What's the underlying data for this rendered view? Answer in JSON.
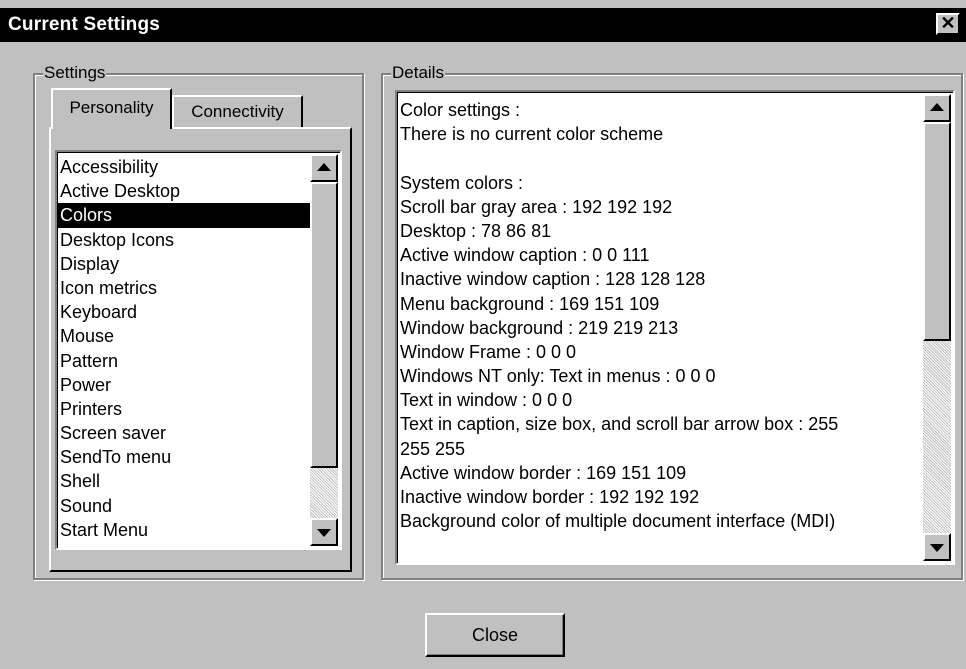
{
  "window": {
    "title": "Current Settings",
    "close_glyph": "✕"
  },
  "settings_group": {
    "label": "Settings",
    "tabs": [
      {
        "label": "Personality",
        "active": true
      },
      {
        "label": "Connectivity",
        "active": false
      }
    ],
    "list_items": [
      "Accessibility",
      "Active Desktop",
      "Colors",
      "Desktop Icons",
      "Display",
      "Icon metrics",
      "Keyboard",
      "Mouse",
      "Pattern",
      "Power",
      "Printers",
      "Screen saver",
      "SendTo menu",
      "Shell",
      "Sound",
      "Start Menu"
    ],
    "selected_item": "Colors"
  },
  "details_group": {
    "label": "Details",
    "lines": [
      "Color settings :",
      "There is no current color scheme",
      "",
      "System colors :",
      "Scroll bar gray area : 192 192 192",
      "Desktop : 78 86 81",
      "Active window caption : 0 0 111",
      "Inactive window caption : 128 128 128",
      "Menu background : 169 151 109",
      "Window background : 219 219 213",
      "Window Frame : 0 0 0",
      "Windows NT only: Text in menus : 0 0 0",
      "Text in window : 0 0 0",
      "Text in caption, size box, and scroll bar arrow box : 255",
      "255 255",
      "Active window border : 169 151 109",
      "Inactive window border : 192 192 192",
      "Background color of multiple document interface (MDI)"
    ]
  },
  "buttons": {
    "close_label": "Close"
  },
  "icons": {
    "title_close": "close-icon",
    "scroll_up": "arrow-up-icon",
    "scroll_down": "arrow-down-icon"
  },
  "colors": {
    "titlebar": "#000000",
    "face": "#c0c0c0",
    "selection": "#000000"
  }
}
